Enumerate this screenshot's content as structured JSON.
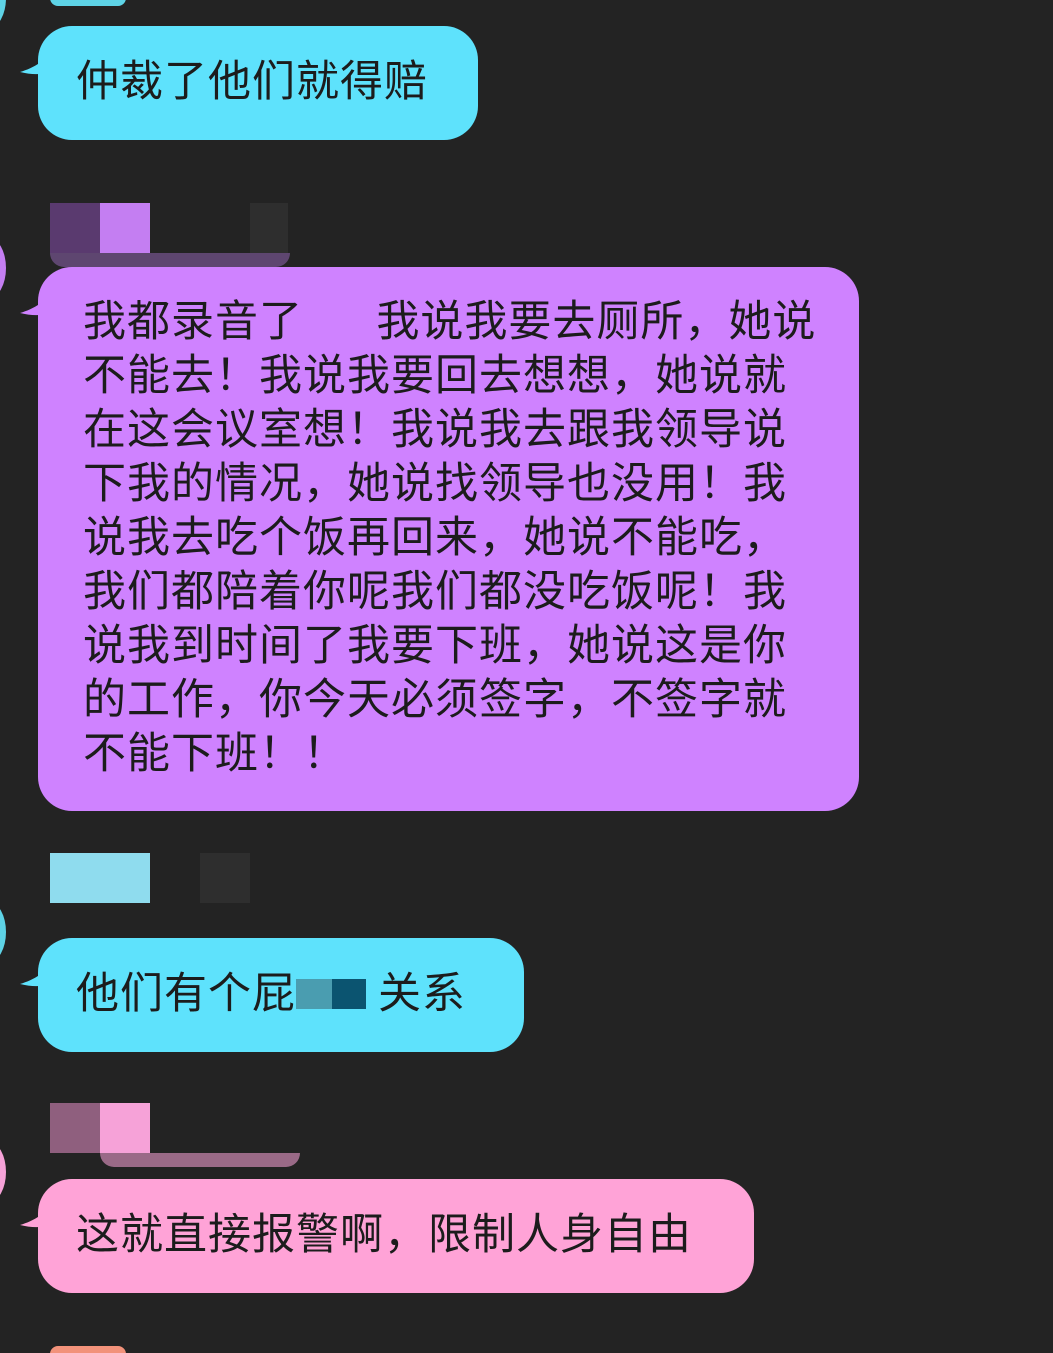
{
  "colors": {
    "background": "#232323",
    "cyan_bubble": "#5ee2fc",
    "purple_bubble": "#cf82ff",
    "pink_bubble": "#ffa3d7",
    "text": "#1c1c1c"
  },
  "messages": [
    {
      "sender": "cyan",
      "text": "仲裁了他们就得赔"
    },
    {
      "sender": "purple",
      "text": "我都录音了     我说我要去厕所，她说不能去！我说我要回去想想，她说就在这会议室想！我说我去跟我领导说下我的情况，她说找领导也没用！我说我去吃个饭再回来，她说不能吃，我们都陪着你呢我们都没吃饭呢！我说我到时间了我要下班，她说这是你的工作，你今天必须签字，不签字就不能下班！！"
    },
    {
      "sender": "cyan",
      "text_before": "他们有个屁",
      "text_after": "关系"
    },
    {
      "sender": "pink",
      "text": "这就直接报警啊，限制人身自由"
    }
  ]
}
